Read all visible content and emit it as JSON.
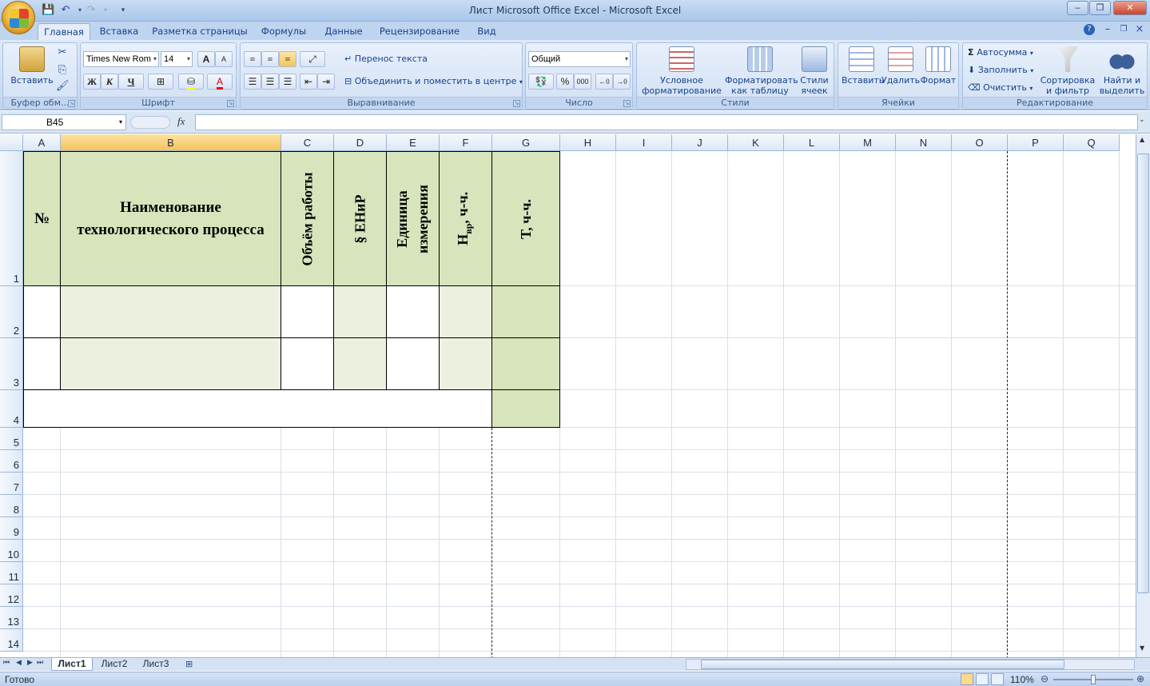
{
  "window": {
    "title": "Лист Microsoft Office Excel - Microsoft Excel",
    "minimize": "‒",
    "maximize": "❐",
    "close": "✕"
  },
  "ribbon_tabs": [
    "Главная",
    "Вставка",
    "Разметка страницы",
    "Формулы",
    "Данные",
    "Рецензирование",
    "Вид"
  ],
  "clipboard": {
    "paste": "Вставить",
    "label": "Буфер обм..."
  },
  "font": {
    "name": "Times New Rom",
    "size": "14",
    "bold": "Ж",
    "italic": "К",
    "underline": "Ч",
    "grow": "A",
    "shrink": "A",
    "label": "Шрифт"
  },
  "alignment": {
    "wrap": "Перенос текста",
    "merge": "Объединить и поместить в центре",
    "label": "Выравнивание"
  },
  "number": {
    "format": "Общий",
    "percent": "%",
    "thousands": "000",
    "label": "Число"
  },
  "styles": {
    "conditional": "Условное форматирование",
    "as_table": "Форматировать как таблицу",
    "cell_styles": "Стили ячеек",
    "label": "Стили"
  },
  "cells": {
    "insert": "Вставить",
    "delete": "Удалить",
    "format": "Формат",
    "label": "Ячейки"
  },
  "editing": {
    "autosum": "Автосумма",
    "fill": "Заполнить",
    "clear": "Очистить",
    "sort": "Сортировка и фильтр",
    "find": "Найти и выделить",
    "label": "Редактирование"
  },
  "formula_bar": {
    "name_box": "B45",
    "fx": "fx",
    "value": ""
  },
  "columns": [
    "A",
    "B",
    "C",
    "D",
    "E",
    "F",
    "G",
    "H",
    "I",
    "J",
    "K",
    "L",
    "M",
    "N",
    "O",
    "P",
    "Q"
  ],
  "selected_column": "B",
  "rows": [
    "1",
    "2",
    "3",
    "4",
    "5",
    "6",
    "7",
    "8",
    "9",
    "10",
    "11",
    "12",
    "13",
    "14"
  ],
  "table_header": {
    "number": "№",
    "process_line1": "Наименование",
    "process_line2": "технологического процесса",
    "volume": "Объём работы",
    "enir": "§ ЕНиР",
    "unit_line1": "Единица",
    "unit_line2": "измерения",
    "nvr_main": "Н",
    "nvr_sub": "вр",
    "nvr_rest": ", ч-ч.",
    "t": "Т, ч-ч."
  },
  "sheets": [
    "Лист1",
    "Лист2",
    "Лист3"
  ],
  "active_sheet": "Лист1",
  "status": {
    "ready": "Готово",
    "zoom": "110%"
  },
  "colors": {
    "header_fill": "#d8e4bc",
    "light_fill": "#ebf1de",
    "ribbon": "#cbdcf1"
  }
}
